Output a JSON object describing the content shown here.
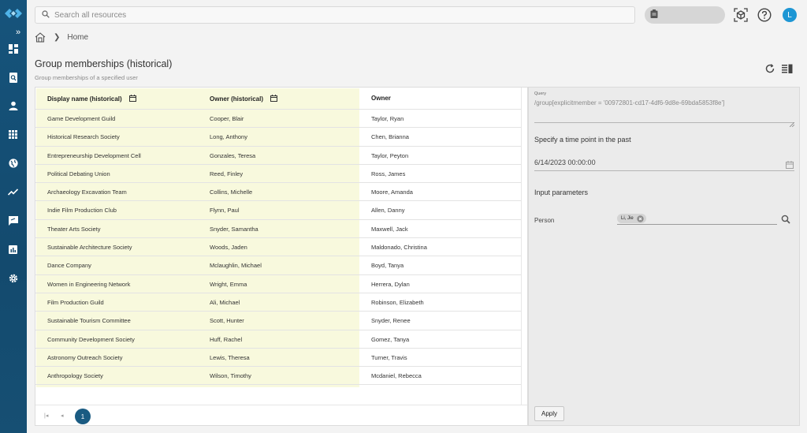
{
  "topbar": {
    "search_placeholder": "Search all resources",
    "user_initial": "L"
  },
  "breadcrumb": {
    "home": "Home"
  },
  "page": {
    "title": "Group memberships (historical)",
    "subtitle": "Group memberships of a specified user"
  },
  "table": {
    "columns": [
      "Display name (historical)",
      "Owner (historical)",
      "Owner"
    ],
    "rows": [
      [
        "Game Development Guild",
        "Cooper, Blair",
        "Taylor, Ryan"
      ],
      [
        "Historical Research Society",
        "Long, Anthony",
        "Chen, Brianna"
      ],
      [
        "Entrepreneurship Development Cell",
        "Gonzales, Teresa",
        "Taylor, Peyton"
      ],
      [
        "Political Debating Union",
        "Reed, Finley",
        "Ross, James"
      ],
      [
        "Archaeology Excavation Team",
        "Collins, Michelle",
        "Moore, Amanda"
      ],
      [
        "Indie Film Production Club",
        "Flynn, Paul",
        "Allen, Danny"
      ],
      [
        "Theater Arts Society",
        "Snyder, Samantha",
        "Maxwell, Jack"
      ],
      [
        "Sustainable Architecture Society",
        "Woods, Jaden",
        "Maldonado, Christina"
      ],
      [
        "Dance Company",
        "Mclaughlin, Michael",
        "Boyd, Tanya"
      ],
      [
        "Women in Engineering Network",
        "Wright, Emma",
        "Herrera, Dylan"
      ],
      [
        "Film Production Guild",
        "Ali, Michael",
        "Robinson, Elizabeth"
      ],
      [
        "Sustainable Tourism Committee",
        "Scott, Hunter",
        "Snyder, Renee"
      ],
      [
        "Community Development Society",
        "Huff, Rachel",
        "Gomez, Tanya"
      ],
      [
        "Astronomy Outreach Society",
        "Lewis, Theresa",
        "Turner, Travis"
      ],
      [
        "Anthropology Society",
        "Wilson, Timothy",
        "Mcdaniel, Rebecca"
      ]
    ],
    "highlight_color": "#f8f9dd"
  },
  "pager": {
    "current_page": "1"
  },
  "panel": {
    "query_label": "Query",
    "query_value": "/group[explicitmember = '00972801-cd17-4df6-9d8e-69bda5853f8e']",
    "time_title": "Specify a time point in the past",
    "time_value": "6/14/2023 00:00:00",
    "params_title": "Input parameters",
    "person_label": "Person",
    "person_chip": "Li, Jie",
    "apply_label": "Apply"
  },
  "colors": {
    "sidebar": "#134a6e",
    "accent": "#1a5b82",
    "avatar": "#1d96d4"
  }
}
